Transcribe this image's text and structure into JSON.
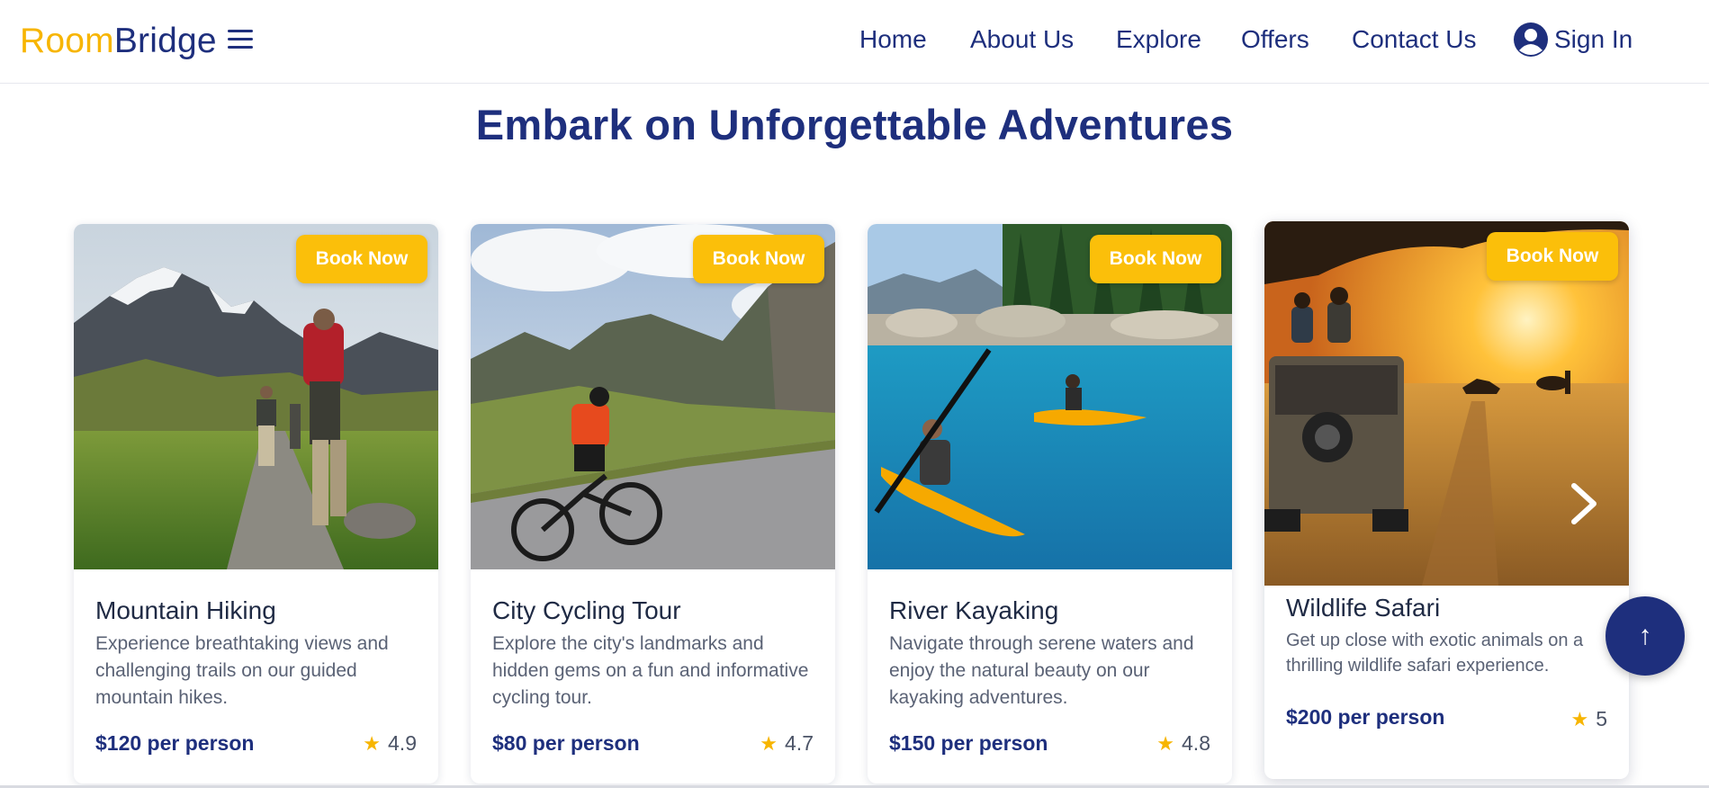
{
  "header": {
    "logo": {
      "part1": "Room",
      "part2": "Bridge"
    },
    "nav": [
      {
        "label": "Home"
      },
      {
        "label": "About Us"
      },
      {
        "label": "Explore"
      },
      {
        "label": "Offers"
      },
      {
        "label": "Contact Us"
      }
    ],
    "sign_in_label": "Sign In",
    "icons": {
      "menu": "hamburger-menu-icon",
      "user": "user-circle-icon"
    }
  },
  "section": {
    "title": "Embark on Unforgettable Adventures"
  },
  "cards": [
    {
      "title": "Mountain Hiking",
      "description": "Experience breathtaking views and challenging trails on our guided mountain hikes.",
      "price": "$120 per person",
      "rating": "4.9",
      "book_label": "Book Now"
    },
    {
      "title": "City Cycling Tour",
      "description": "Explore the city's landmarks and hidden gems on a fun and informative cycling tour.",
      "price": "$80 per person",
      "rating": "4.7",
      "book_label": "Book Now"
    },
    {
      "title": "River Kayaking",
      "description": "Navigate through serene waters and enjoy the natural beauty on our kayaking adventures.",
      "price": "$150 per person",
      "rating": "4.8",
      "book_label": "Book Now"
    },
    {
      "title": "Wildlife Safari",
      "description": "Get up close with exotic animals on a thrilling wildlife safari experience.",
      "price": "$200 per person",
      "rating": "5",
      "book_label": "Book Now"
    }
  ],
  "controls": {
    "scroll_top_symbol": "↑",
    "next_icon": "chevron-right-icon"
  },
  "colors": {
    "brand_yellow": "#f7b500",
    "brand_navy": "#1e2f7d",
    "button_yellow": "#fbbf0a"
  }
}
